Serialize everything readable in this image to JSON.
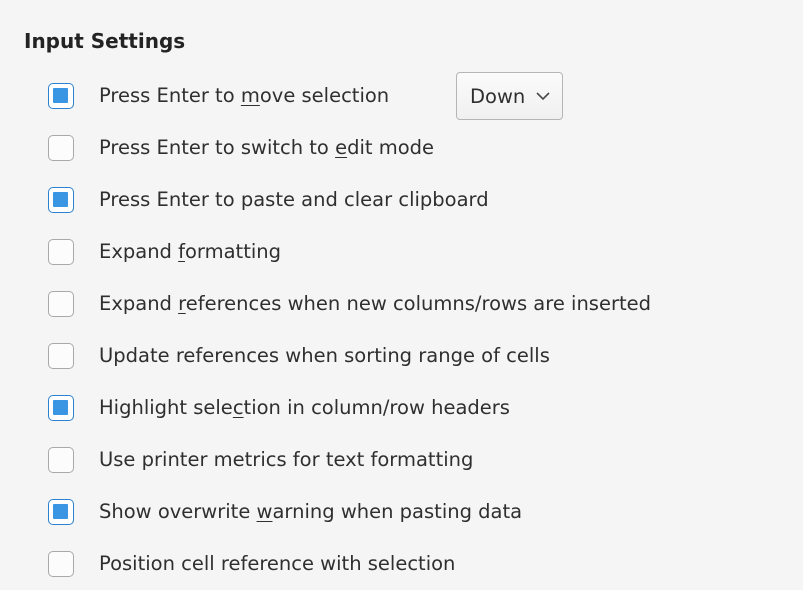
{
  "section": {
    "title": "Input Settings"
  },
  "options": [
    {
      "before": "Press Enter to ",
      "key": "m",
      "after": "ove selection",
      "checked": true
    },
    {
      "before": "Press Enter to switch to ",
      "key": "e",
      "after": "dit mode",
      "checked": false
    },
    {
      "before": "Press Enter to paste and clear clipboard",
      "key": "",
      "after": "",
      "checked": true
    },
    {
      "before": "Expand ",
      "key": "f",
      "after": "ormatting",
      "checked": false
    },
    {
      "before": "Expand ",
      "key": "r",
      "after": "eferences when new columns/rows are inserted",
      "checked": false
    },
    {
      "before": "Update references when sorting range of cells",
      "key": "",
      "after": "",
      "checked": false
    },
    {
      "before": "Highlight sele",
      "key": "c",
      "after": "tion in column/row headers",
      "checked": true
    },
    {
      "before": "Use printer metrics for text formatting",
      "key": "",
      "after": "",
      "checked": false
    },
    {
      "before": "Show overwrite ",
      "key": "w",
      "after": "arning when pasting data",
      "checked": true
    },
    {
      "before": "Position cell reference with selection",
      "key": "",
      "after": "",
      "checked": false
    }
  ],
  "move_direction": {
    "selected": "Down"
  },
  "colors": {
    "accent": "#3a95e3",
    "background": "#f5f5f5"
  },
  "icons": {
    "dropdown": "chevron-down-icon"
  }
}
